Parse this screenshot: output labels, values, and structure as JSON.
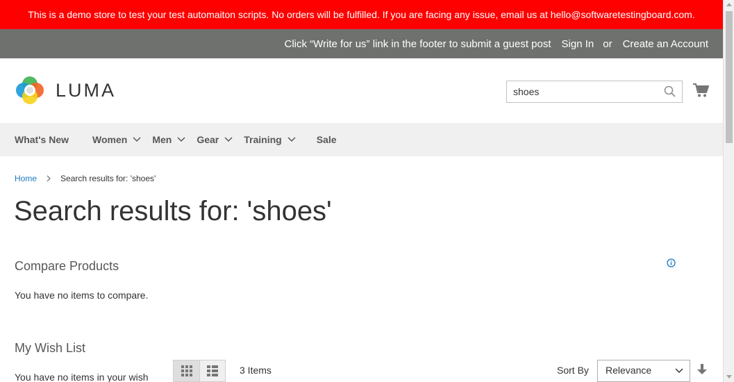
{
  "demo_notice": "This is a demo store to test your test automaiton scripts. No orders will be fulfilled. If you are facing any issue, email us at hello@softwaretestingboard.com.",
  "panel": {
    "guest_post": "Click “Write for us” link in the footer to submit a guest post",
    "sign_in": "Sign In",
    "or": "or",
    "create_account": "Create an Account"
  },
  "logo": {
    "text": "LUMA",
    "icon": "luma-logo-icon"
  },
  "search": {
    "value": "shoes",
    "icon": "search-icon"
  },
  "cart": {
    "icon": "cart-icon"
  },
  "nav": {
    "items": [
      {
        "label": "What's New",
        "dropdown": false
      },
      {
        "label": "Women",
        "dropdown": true
      },
      {
        "label": "Men",
        "dropdown": true
      },
      {
        "label": "Gear",
        "dropdown": true
      },
      {
        "label": "Training",
        "dropdown": true
      },
      {
        "label": "Sale",
        "dropdown": false
      }
    ]
  },
  "breadcrumb": {
    "home": "Home",
    "current": "Search results for: 'shoes'"
  },
  "page_title": "Search results for: 'shoes'",
  "compare": {
    "title": "Compare Products",
    "empty": "You have no items to compare."
  },
  "wishlist": {
    "title": "My Wish List",
    "empty": "You have no items in your wish"
  },
  "toolbar": {
    "amount": "3 Items",
    "sort_label": "Sort By",
    "sort_value": "Relevance"
  },
  "colors": {
    "demo_bar": "#ff0000",
    "panel": "#6e716e",
    "nav_bg": "#f0f0f0",
    "link": "#1979c3"
  }
}
